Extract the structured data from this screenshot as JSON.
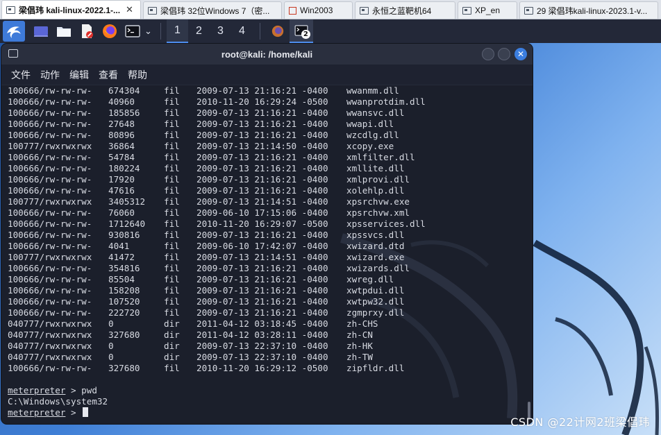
{
  "vm_tabs": [
    {
      "label": "梁倡玮 kali-linux-2022.1-...",
      "icon": "vm-icon",
      "active": true,
      "closable": true
    },
    {
      "label": "梁倡玮 32位Windows 7（密...",
      "icon": "vm-icon",
      "active": false,
      "closable": false
    },
    {
      "label": "Win2003",
      "icon": "windows-icon",
      "active": false,
      "closable": false
    },
    {
      "label": "永恒之蓝靶机64",
      "icon": "vm-icon",
      "active": false,
      "closable": false
    },
    {
      "label": "XP_en",
      "icon": "vm-icon",
      "active": false,
      "closable": false
    },
    {
      "label": "29 梁倡玮kali-linux-2023.1-v...",
      "icon": "vm-icon",
      "active": false,
      "closable": false
    }
  ],
  "tab_close_glyph": "✕",
  "panel": {
    "workspaces": [
      "1",
      "2",
      "3",
      "4"
    ],
    "active_workspace": "1",
    "terminal_task_badge": "2",
    "terminal_launcher_arrow": "⌄"
  },
  "window": {
    "title": "root@kali: /home/kali",
    "close_glyph": "✕",
    "menu": [
      "文件",
      "动作",
      "编辑",
      "查看",
      "帮助"
    ]
  },
  "terminal": {
    "listing": [
      {
        "mode": "100666/rw-rw-rw-",
        "size": "674304",
        "type": "fil",
        "date": "2009-07-13 21:16:21 -0400",
        "name": "wwanmm.dll"
      },
      {
        "mode": "100666/rw-rw-rw-",
        "size": "40960",
        "type": "fil",
        "date": "2010-11-20 16:29:24 -0500",
        "name": "wwanprotdim.dll"
      },
      {
        "mode": "100666/rw-rw-rw-",
        "size": "185856",
        "type": "fil",
        "date": "2009-07-13 21:16:21 -0400",
        "name": "wwansvc.dll"
      },
      {
        "mode": "100666/rw-rw-rw-",
        "size": "27648",
        "type": "fil",
        "date": "2009-07-13 21:16:21 -0400",
        "name": "wwapi.dll"
      },
      {
        "mode": "100666/rw-rw-rw-",
        "size": "80896",
        "type": "fil",
        "date": "2009-07-13 21:16:21 -0400",
        "name": "wzcdlg.dll"
      },
      {
        "mode": "100777/rwxrwxrwx",
        "size": "36864",
        "type": "fil",
        "date": "2009-07-13 21:14:50 -0400",
        "name": "xcopy.exe"
      },
      {
        "mode": "100666/rw-rw-rw-",
        "size": "54784",
        "type": "fil",
        "date": "2009-07-13 21:16:21 -0400",
        "name": "xmlfilter.dll"
      },
      {
        "mode": "100666/rw-rw-rw-",
        "size": "180224",
        "type": "fil",
        "date": "2009-07-13 21:16:21 -0400",
        "name": "xmllite.dll"
      },
      {
        "mode": "100666/rw-rw-rw-",
        "size": "17920",
        "type": "fil",
        "date": "2009-07-13 21:16:21 -0400",
        "name": "xmlprovi.dll"
      },
      {
        "mode": "100666/rw-rw-rw-",
        "size": "47616",
        "type": "fil",
        "date": "2009-07-13 21:16:21 -0400",
        "name": "xolehlp.dll"
      },
      {
        "mode": "100777/rwxrwxrwx",
        "size": "3405312",
        "type": "fil",
        "date": "2009-07-13 21:14:51 -0400",
        "name": "xpsrchvw.exe"
      },
      {
        "mode": "100666/rw-rw-rw-",
        "size": "76060",
        "type": "fil",
        "date": "2009-06-10 17:15:06 -0400",
        "name": "xpsrchvw.xml"
      },
      {
        "mode": "100666/rw-rw-rw-",
        "size": "1712640",
        "type": "fil",
        "date": "2010-11-20 16:29:07 -0500",
        "name": "xpsservices.dll"
      },
      {
        "mode": "100666/rw-rw-rw-",
        "size": "930816",
        "type": "fil",
        "date": "2009-07-13 21:16:21 -0400",
        "name": "xpssvcs.dll"
      },
      {
        "mode": "100666/rw-rw-rw-",
        "size": "4041",
        "type": "fil",
        "date": "2009-06-10 17:42:07 -0400",
        "name": "xwizard.dtd"
      },
      {
        "mode": "100777/rwxrwxrwx",
        "size": "41472",
        "type": "fil",
        "date": "2009-07-13 21:14:51 -0400",
        "name": "xwizard.exe"
      },
      {
        "mode": "100666/rw-rw-rw-",
        "size": "354816",
        "type": "fil",
        "date": "2009-07-13 21:16:21 -0400",
        "name": "xwizards.dll"
      },
      {
        "mode": "100666/rw-rw-rw-",
        "size": "85504",
        "type": "fil",
        "date": "2009-07-13 21:16:21 -0400",
        "name": "xwreg.dll"
      },
      {
        "mode": "100666/rw-rw-rw-",
        "size": "158208",
        "type": "fil",
        "date": "2009-07-13 21:16:21 -0400",
        "name": "xwtpdui.dll"
      },
      {
        "mode": "100666/rw-rw-rw-",
        "size": "107520",
        "type": "fil",
        "date": "2009-07-13 21:16:21 -0400",
        "name": "xwtpw32.dll"
      },
      {
        "mode": "100666/rw-rw-rw-",
        "size": "222720",
        "type": "fil",
        "date": "2009-07-13 21:16:21 -0400",
        "name": "zgmprxy.dll"
      },
      {
        "mode": "040777/rwxrwxrwx",
        "size": "0",
        "type": "dir",
        "date": "2011-04-12 03:18:45 -0400",
        "name": "zh-CHS"
      },
      {
        "mode": "040777/rwxrwxrwx",
        "size": "327680",
        "type": "dir",
        "date": "2011-04-12 03:28:11 -0400",
        "name": "zh-CN"
      },
      {
        "mode": "040777/rwxrwxrwx",
        "size": "0",
        "type": "dir",
        "date": "2009-07-13 22:37:10 -0400",
        "name": "zh-HK"
      },
      {
        "mode": "040777/rwxrwxrwx",
        "size": "0",
        "type": "dir",
        "date": "2009-07-13 22:37:10 -0400",
        "name": "zh-TW"
      },
      {
        "mode": "100666/rw-rw-rw-",
        "size": "327680",
        "type": "fil",
        "date": "2010-11-20 16:29:12 -0500",
        "name": "zipfldr.dll"
      }
    ],
    "prompt_word": "meterpreter",
    "prompt_suffix": " > ",
    "command": "pwd",
    "output": "C:\\Windows\\system32",
    "current_input": ""
  },
  "watermark": "CSDN @22计网2班梁倡玮",
  "colors": {
    "accent": "#4e8ef0",
    "terminal_bg": "#1b1f2b",
    "terminal_text": "#d8dbe3",
    "close_button": "#3b7ee0"
  }
}
